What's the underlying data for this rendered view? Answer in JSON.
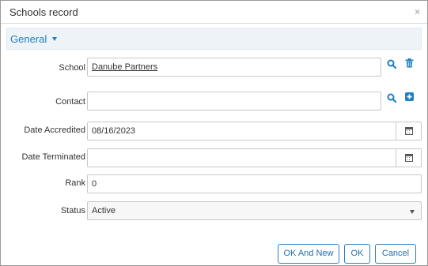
{
  "window": {
    "title": "Schools record",
    "close_glyph": "×"
  },
  "section": {
    "title": "General"
  },
  "fields": {
    "school": {
      "label": "School",
      "value": "Danube Partners"
    },
    "contact": {
      "label": "Contact",
      "value": ""
    },
    "date_accredited": {
      "label": "Date Accredited",
      "value": "08/16/2023"
    },
    "date_terminated": {
      "label": "Date Terminated",
      "value": ""
    },
    "rank": {
      "label": "Rank",
      "value": "0"
    },
    "status": {
      "label": "Status",
      "value": "Active"
    }
  },
  "buttons": {
    "ok_and_new": "OK And New",
    "ok": "OK",
    "cancel": "Cancel"
  },
  "icons": {
    "school_search": "search-icon",
    "school_delete": "trash-icon",
    "contact_search": "search-icon",
    "contact_add": "plus-square-icon",
    "calendar": "calendar-icon",
    "dropdown": "chevron-down-icon"
  },
  "colors": {
    "accent": "#1f7fc4",
    "header_bg": "#eef3f8",
    "border": "#c8c8c8"
  }
}
